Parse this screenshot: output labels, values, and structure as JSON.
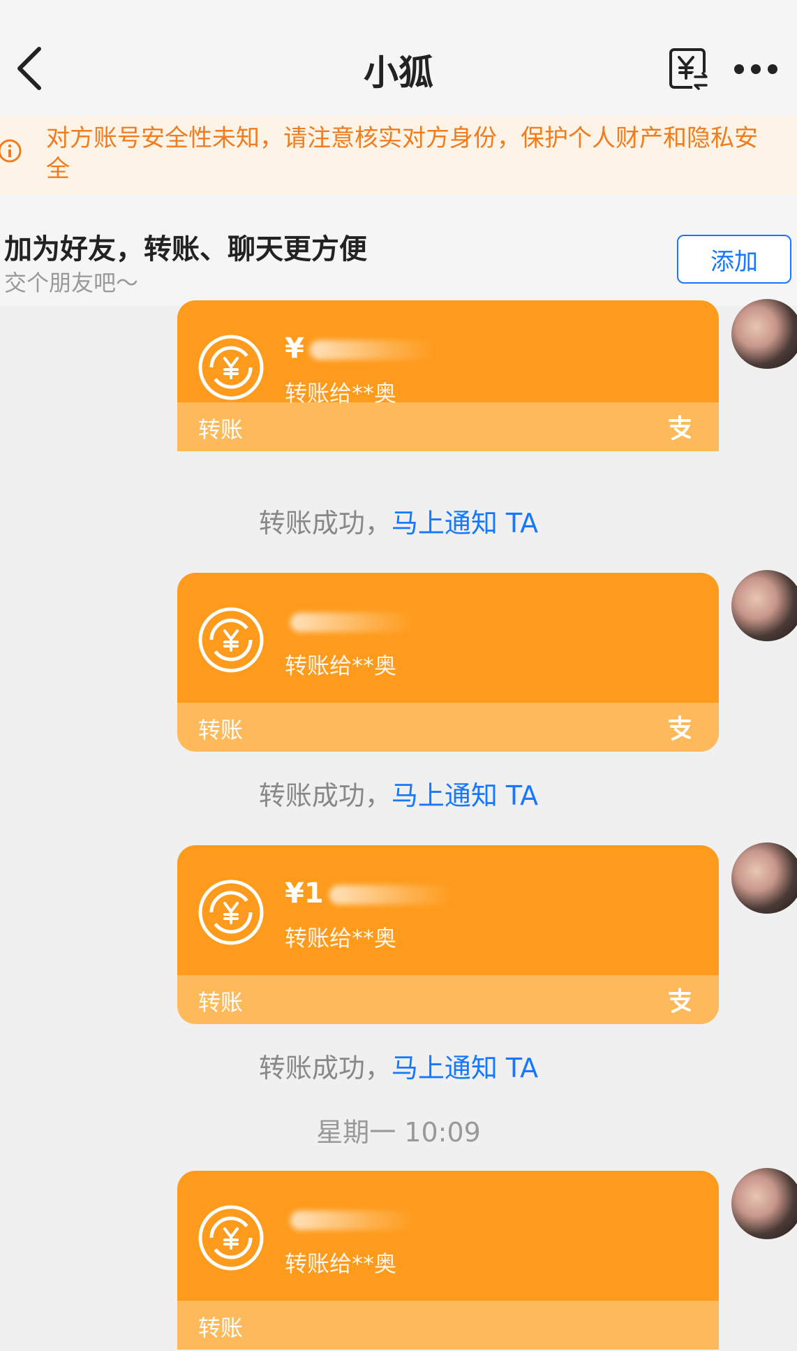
{
  "header": {
    "title": "小狐",
    "back_icon": "chevron-left-icon",
    "transfer_icon": "yuan-transfer-icon",
    "more_icon": "more-dots-icon"
  },
  "warning": {
    "icon": "info-circle-icon",
    "text": "对方账号安全性未知，请注意核实对方身份，保护个人财产和隐私安全",
    "color": "#f07c20"
  },
  "friend_prompt": {
    "title": "加为好友，转账、聊天更方便",
    "subtitle": "交个朋友吧～",
    "add_button": "添加"
  },
  "colors": {
    "card_top": "#fe9b1c",
    "card_bottom": "#feba5a",
    "link": "#1677ff"
  },
  "messages": [
    {
      "amount_prefix": "¥",
      "recipient": "转账给**奥",
      "label": "转账",
      "status": "转账成功，",
      "action": "马上通知 TA"
    },
    {
      "amount_prefix": "",
      "recipient": "转账给**奥",
      "label": "转账",
      "status": "转账成功，",
      "action": "马上通知 TA"
    },
    {
      "amount_prefix": "¥1",
      "recipient": "转账给**奥",
      "label": "转账",
      "status": "转账成功，",
      "action": "马上通知 TA"
    },
    {
      "amount_prefix": "",
      "recipient": "转账给**奥",
      "label": "转账"
    }
  ],
  "timestamp": "星期一 10:09"
}
